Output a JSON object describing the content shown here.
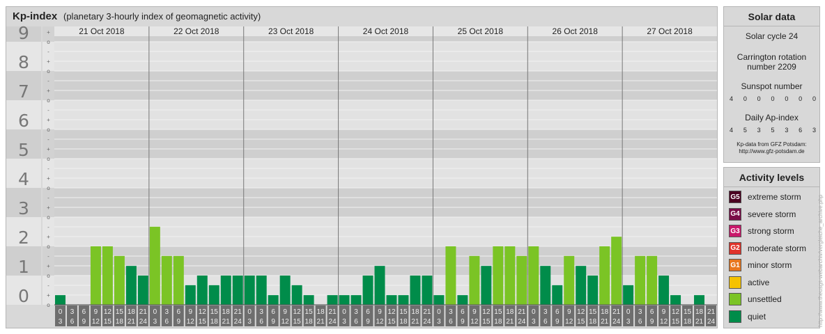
{
  "header": {
    "title": "Kp-index",
    "subtitle": "(planetary 3-hourly index of geomagnetic activity)"
  },
  "chart_data": {
    "type": "bar",
    "title": "Kp-index",
    "subtitle": "(planetary 3-hourly index of geomagnetic activity)",
    "y_major_ticks": [
      "0",
      "1",
      "2",
      "3",
      "4",
      "5",
      "6",
      "7",
      "8",
      "9"
    ],
    "y_minor_ticks": [
      "-",
      "o",
      "+"
    ],
    "ylim": [
      0,
      9.33
    ],
    "days": [
      "21 Oct 2018",
      "22 Oct 2018",
      "23 Oct 2018",
      "24 Oct 2018",
      "25 Oct 2018",
      "26 Oct 2018",
      "27 Oct 2018"
    ],
    "hour_top": [
      "0",
      "3",
      "6",
      "9",
      "12",
      "15",
      "18",
      "21"
    ],
    "hour_bottom": [
      "3",
      "6",
      "9",
      "12",
      "15",
      "18",
      "21",
      "24"
    ],
    "values": [
      0.33,
      0,
      0,
      2,
      2,
      1.67,
      1.33,
      1,
      2.67,
      1.67,
      1.67,
      0.67,
      1,
      0.67,
      1,
      1,
      1,
      1,
      0.33,
      1,
      0.67,
      0.33,
      0,
      0.33,
      0.33,
      0.33,
      1,
      1.33,
      0.33,
      0.33,
      1,
      1,
      0.33,
      2,
      0.33,
      1.67,
      1.33,
      2,
      2,
      1.67,
      2,
      1.33,
      0.67,
      1.67,
      1.33,
      1,
      2,
      2.33,
      0.67,
      1.67,
      1.67,
      1,
      0.33,
      0,
      0.33,
      0
    ],
    "colors": {
      "quiet": "#008c4a",
      "unsettled": "#7bc425",
      "band_light": "#e2e2e2",
      "band_dark": "#cfcfcf",
      "axis_box": "#6e6e6e"
    }
  },
  "solar": {
    "title": "Solar data",
    "cycle": "Solar cycle 24",
    "carrington_line1": "Carrington rotation",
    "carrington_line2": "number 2209",
    "sunspot_label": "Sunspot number",
    "sunspot_values": [
      "4",
      "0",
      "0",
      "0",
      "0",
      "0",
      "0"
    ],
    "ap_label": "Daily Ap-index",
    "ap_values": [
      "4",
      "5",
      "3",
      "5",
      "3",
      "6",
      "3"
    ],
    "source_line1": "Kp-data from GFZ Potsdam:",
    "source_line2": "http://www.gfz-potsdam.de"
  },
  "activity": {
    "title": "Activity levels",
    "levels": [
      {
        "code": "G5",
        "label": "extreme storm",
        "color": "#4a0020"
      },
      {
        "code": "G4",
        "label": "severe storm",
        "color": "#7a0c48"
      },
      {
        "code": "G3",
        "label": "strong storm",
        "color": "#c8186a"
      },
      {
        "code": "G2",
        "label": "moderate storm",
        "color": "#e0332a"
      },
      {
        "code": "G1",
        "label": "minor storm",
        "color": "#e8761e"
      },
      {
        "code": "",
        "label": "active",
        "color": "#f5c200"
      },
      {
        "code": "",
        "label": "unsettled",
        "color": "#7bc425"
      },
      {
        "code": "",
        "label": "quiet",
        "color": "#008c4a"
      }
    ]
  },
  "credit": "http://www.theusgs-webarchiv/vergleiche_archive.php"
}
